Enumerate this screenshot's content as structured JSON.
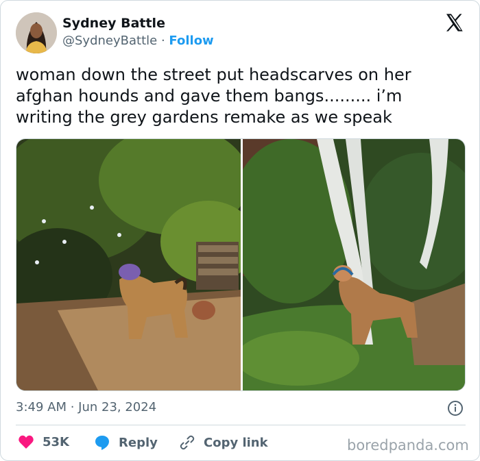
{
  "author": {
    "name": "Sydney Battle",
    "handle": "@SydneyBattle",
    "separator": "·",
    "follow_label": "Follow"
  },
  "tweet": {
    "lines": [
      "woman down the street put headscarves on her",
      "afghan hounds and gave them bangs......... i’m",
      "writing the grey gardens remake as we speak"
    ],
    "timestamp": "3:49 AM · Jun 23, 2024"
  },
  "actions": {
    "like_count": "53K",
    "reply_label": "Reply",
    "copy_label": "Copy link"
  },
  "watermark": "boredpanda.com",
  "colors": {
    "accent": "#1d9bf0",
    "like": "#f91880",
    "text": "#0f1419",
    "secondary": "#536471",
    "border": "#cfd9de"
  },
  "icons": {
    "brand": "x-logo-icon",
    "info": "info-icon",
    "like": "heart-icon",
    "reply": "speech-bubble-icon",
    "copy": "link-icon"
  }
}
